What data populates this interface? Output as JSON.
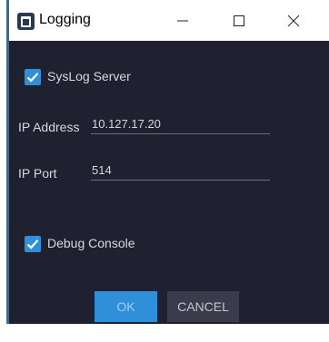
{
  "window": {
    "title": "Logging",
    "icons": {
      "app": "logging-app-icon",
      "minimize": "minimize-icon",
      "maximize": "maximize-icon",
      "close": "close-icon"
    }
  },
  "form": {
    "syslog": {
      "label": "SysLog Server",
      "checked": true
    },
    "ip_address": {
      "label": "IP Address",
      "value": "10.127.17.20"
    },
    "ip_port": {
      "label": "IP Port",
      "value": "514"
    },
    "debug_console": {
      "label": "Debug Console",
      "checked": true
    }
  },
  "buttons": {
    "ok": "OK",
    "cancel": "CANCEL"
  },
  "colors": {
    "accent": "#2f8fd8",
    "panel_bg": "#1f2131",
    "text": "#d6d8de"
  }
}
